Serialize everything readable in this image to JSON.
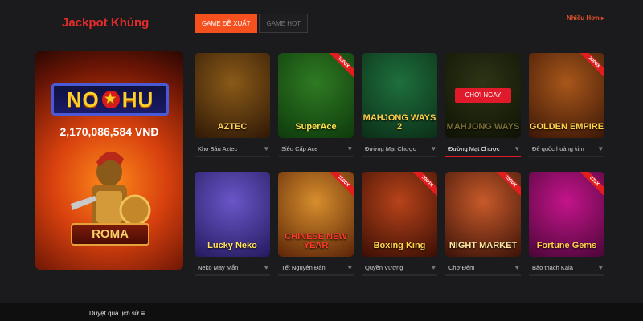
{
  "header": {
    "title": "Jackpot Khủng",
    "tabs": [
      {
        "label": "GAME ĐỀ XUẤT",
        "active": true
      },
      {
        "label": "GAME HOT",
        "active": false
      }
    ],
    "more_label": "Nhiều Hơn ▸"
  },
  "jackpot": {
    "brand": "NỔHŨ",
    "brand_left": "NO",
    "brand_star": "★",
    "brand_right": "HU",
    "amount": "2,170,086,584 VNĐ",
    "game": "ROMA"
  },
  "games": [
    {
      "name": "Kho Báu Aztec",
      "logo": "AZTEC",
      "bg": "#8a5a18",
      "bg2": "#2f1806",
      "fg": "#ffd45a",
      "badge": "",
      "hover": false
    },
    {
      "name": "Siêu Cấp Ace",
      "logo": "SuperAce",
      "bg": "#2f7a23",
      "bg2": "#0e3a0c",
      "fg": "#ffe14a",
      "badge": "1500X",
      "hover": false
    },
    {
      "name": "Đường Mạt Chược",
      "logo": "MAHJONG WAYS 2",
      "bg": "#1e6f3c",
      "bg2": "#0b2e18",
      "fg": "#ffd04a",
      "badge": "",
      "hover": false
    },
    {
      "name": "Đường Mạt Chược",
      "logo": "MAHJONG WAYS",
      "bg": "#5b6a2a",
      "bg2": "#1d240a",
      "fg": "#f1d86a",
      "badge": "",
      "hover": true,
      "play_label": "CHƠI NGAY"
    },
    {
      "name": "Đế quốc hoàng kim",
      "logo": "GOLDEN EMPIRE",
      "bg": "#a8571a",
      "bg2": "#3a1606",
      "fg": "#ffd24a",
      "badge": "2000X",
      "hover": false
    },
    {
      "name": "Neko May Mắn",
      "logo": "Lucky Neko",
      "bg": "#6a56c8",
      "bg2": "#241a5e",
      "fg": "#ffe45a",
      "badge": "",
      "hover": false
    },
    {
      "name": "Tết Nguyên Đán",
      "logo": "CHINESE NEW YEAR",
      "bg": "#d78e2c",
      "bg2": "#5a2408",
      "fg": "#ff3a2a",
      "badge": "1500X",
      "hover": false
    },
    {
      "name": "Quyền Vương",
      "logo": "Boxing King",
      "bg": "#b7431a",
      "bg2": "#3a0e04",
      "fg": "#ffd84a",
      "badge": "2000X",
      "hover": false
    },
    {
      "name": "Chợ Đêm",
      "logo": "NIGHT MARKET",
      "bg": "#c85a2a",
      "bg2": "#3a1208",
      "fg": "#ffe6a0",
      "badge": "1500X",
      "hover": false
    },
    {
      "name": "Bảo thạch Kala",
      "logo": "Fortune Gems",
      "bg": "#c4148a",
      "bg2": "#4a0638",
      "fg": "#ffd24a",
      "badge": "375X",
      "hover": false
    }
  ],
  "footer": {
    "text": "Duyệt qua lịch sử ≡"
  },
  "icons": {
    "heart": "♥"
  }
}
